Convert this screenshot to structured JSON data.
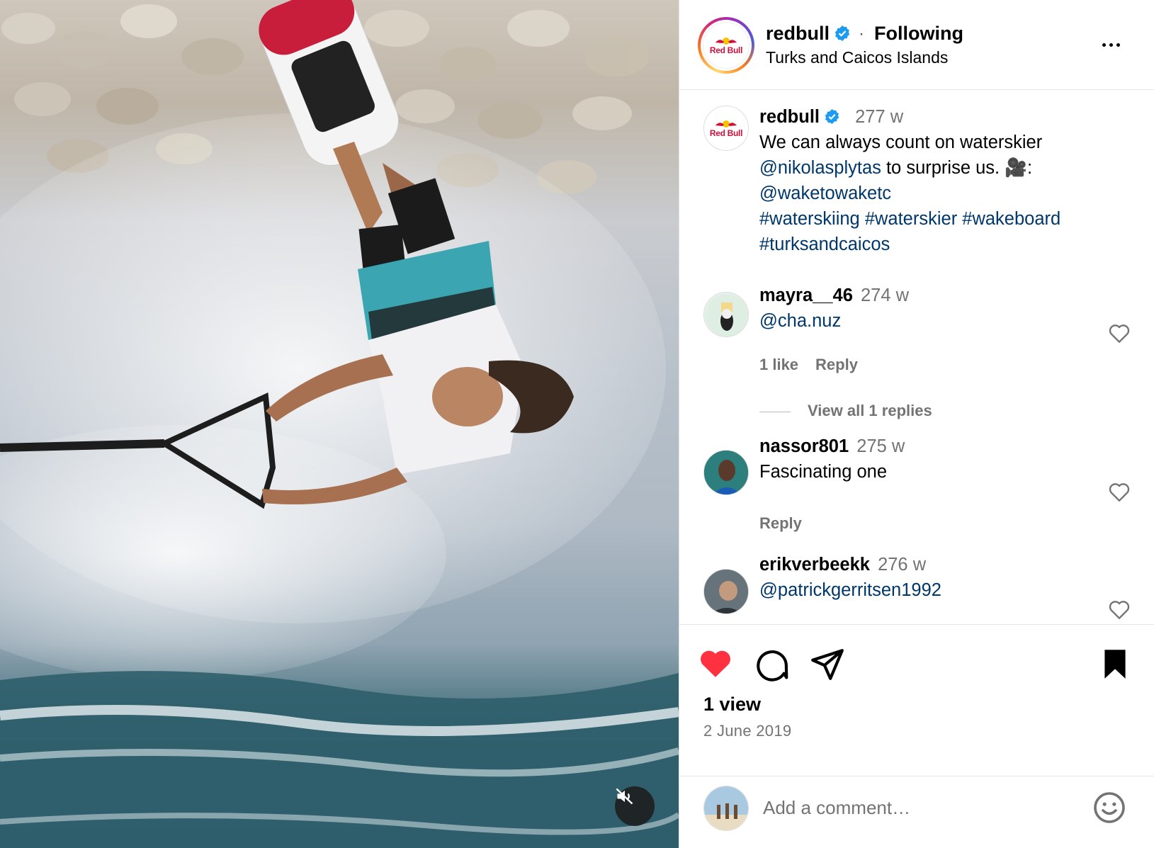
{
  "post": {
    "username": "redbull",
    "verified": true,
    "follow_status": "Following",
    "location": "Turks and Caicos Islands",
    "avatar_text": "Red Bull"
  },
  "media": {
    "mute_icon": "speaker-muted-icon"
  },
  "caption": {
    "username": "redbull",
    "time": "277 w",
    "text_1": "We can always count on waterskier ",
    "mention_1": "@nikolasplytas",
    "text_2": " to surprise us. 🎥:",
    "mention_2": "@waketowaketc",
    "hashtags_line_1": "#waterskiing #waterskier #wakeboard",
    "hashtags_line_2": "#turksandcaicos"
  },
  "comments": [
    {
      "username": "mayra__46",
      "time": "274 w",
      "text": "@cha.nuz",
      "likes": "1 like",
      "reply": "Reply",
      "view_replies": "View all 1 replies"
    },
    {
      "username": "nassor801",
      "time": "275 w",
      "text": "Fascinating one",
      "reply": "Reply"
    },
    {
      "username": "erikverbeekk",
      "time": "276 w",
      "text": "@patrickgerritsen1992"
    }
  ],
  "actions": {
    "liked": true,
    "saved": true,
    "views": "1 view",
    "date": "2 June 2019",
    "like_color": "#ff3040"
  },
  "add_comment": {
    "placeholder": "Add a comment…"
  }
}
